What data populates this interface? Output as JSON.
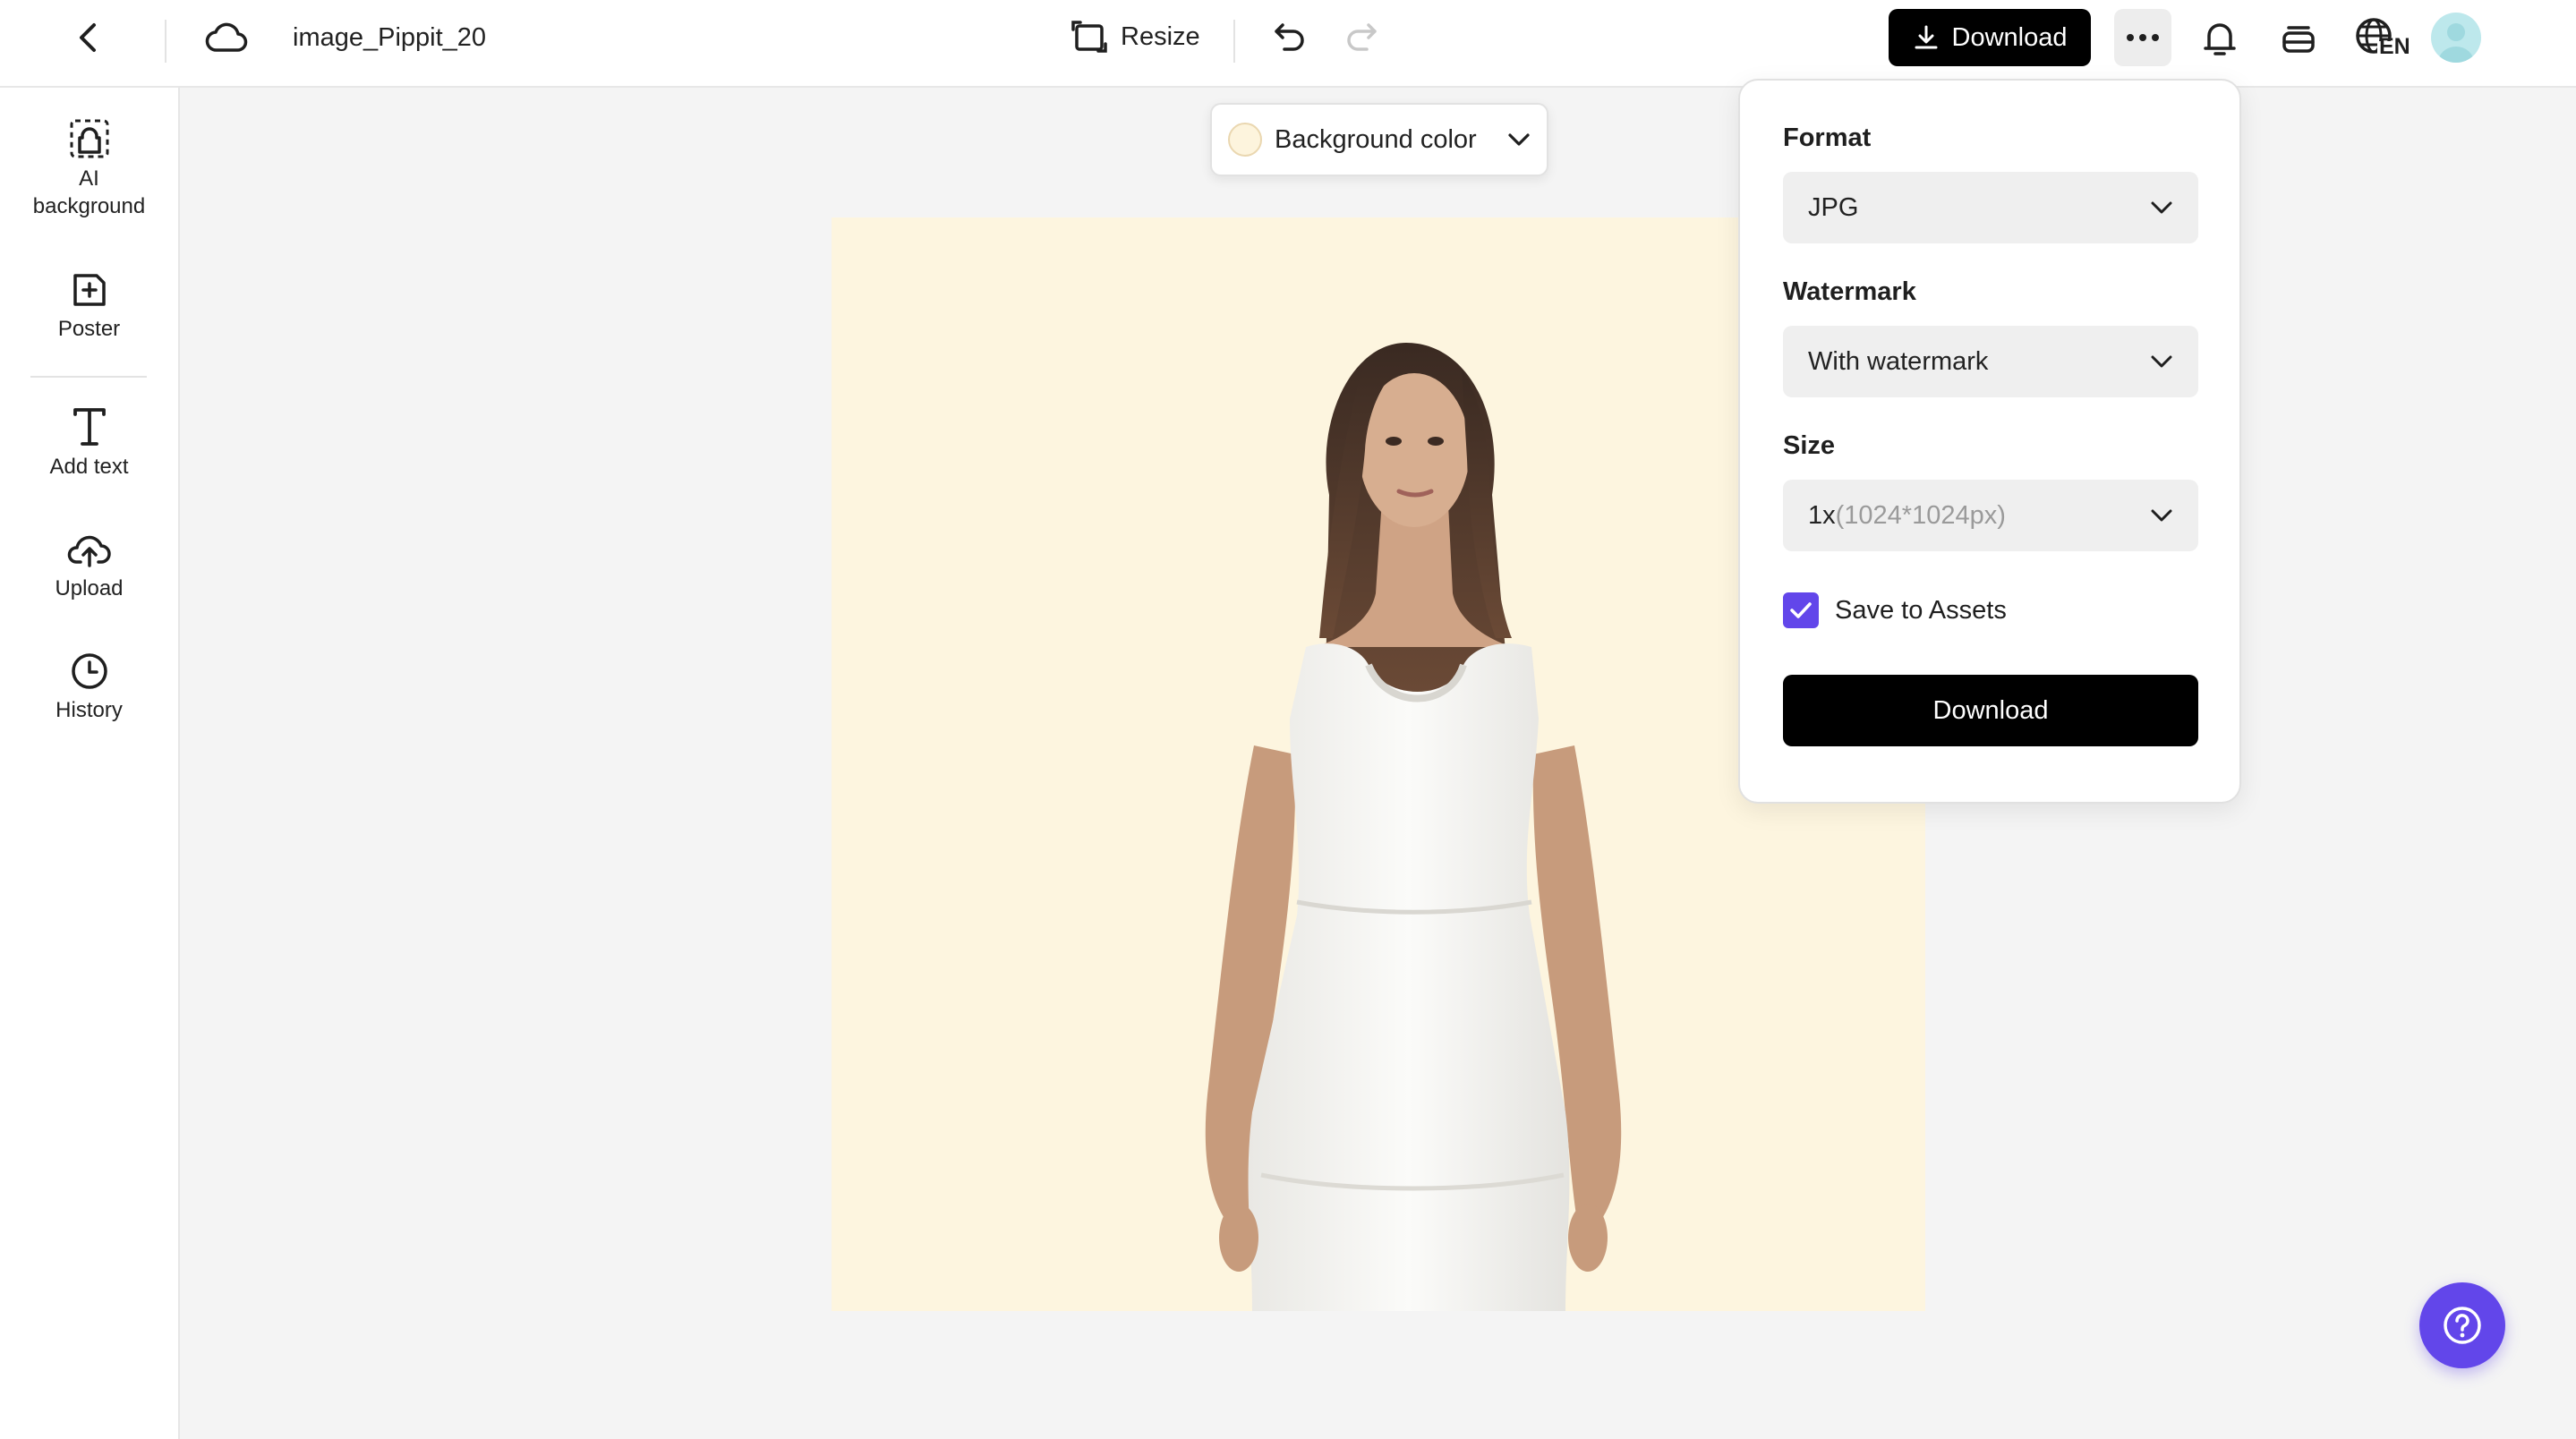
{
  "header": {
    "file_name": "image_Pippit_20",
    "resize_label": "Resize",
    "download_label": "Download",
    "language_code": "EN"
  },
  "sidebar": {
    "items": [
      {
        "label": "AI\nbackground",
        "icon": "ai-background-icon"
      },
      {
        "label": "Poster",
        "icon": "poster-icon"
      },
      {
        "label": "Add text",
        "icon": "text-icon"
      },
      {
        "label": "Upload",
        "icon": "upload-cloud-icon"
      },
      {
        "label": "History",
        "icon": "clock-icon"
      }
    ]
  },
  "canvas": {
    "background_color_label": "Background color",
    "background_color": "#fdf5df"
  },
  "download_panel": {
    "format_label": "Format",
    "format_value": "JPG",
    "watermark_label": "Watermark",
    "watermark_value": "With watermark",
    "size_label": "Size",
    "size_value_prefix": "1x",
    "size_value_detail": "(1024*1024px)",
    "save_to_assets_label": "Save to Assets",
    "save_to_assets_checked": true,
    "download_button_label": "Download"
  },
  "colors": {
    "accent": "#6246ea",
    "primary_button": "#000000",
    "canvas_bg": "#fdf5df"
  }
}
